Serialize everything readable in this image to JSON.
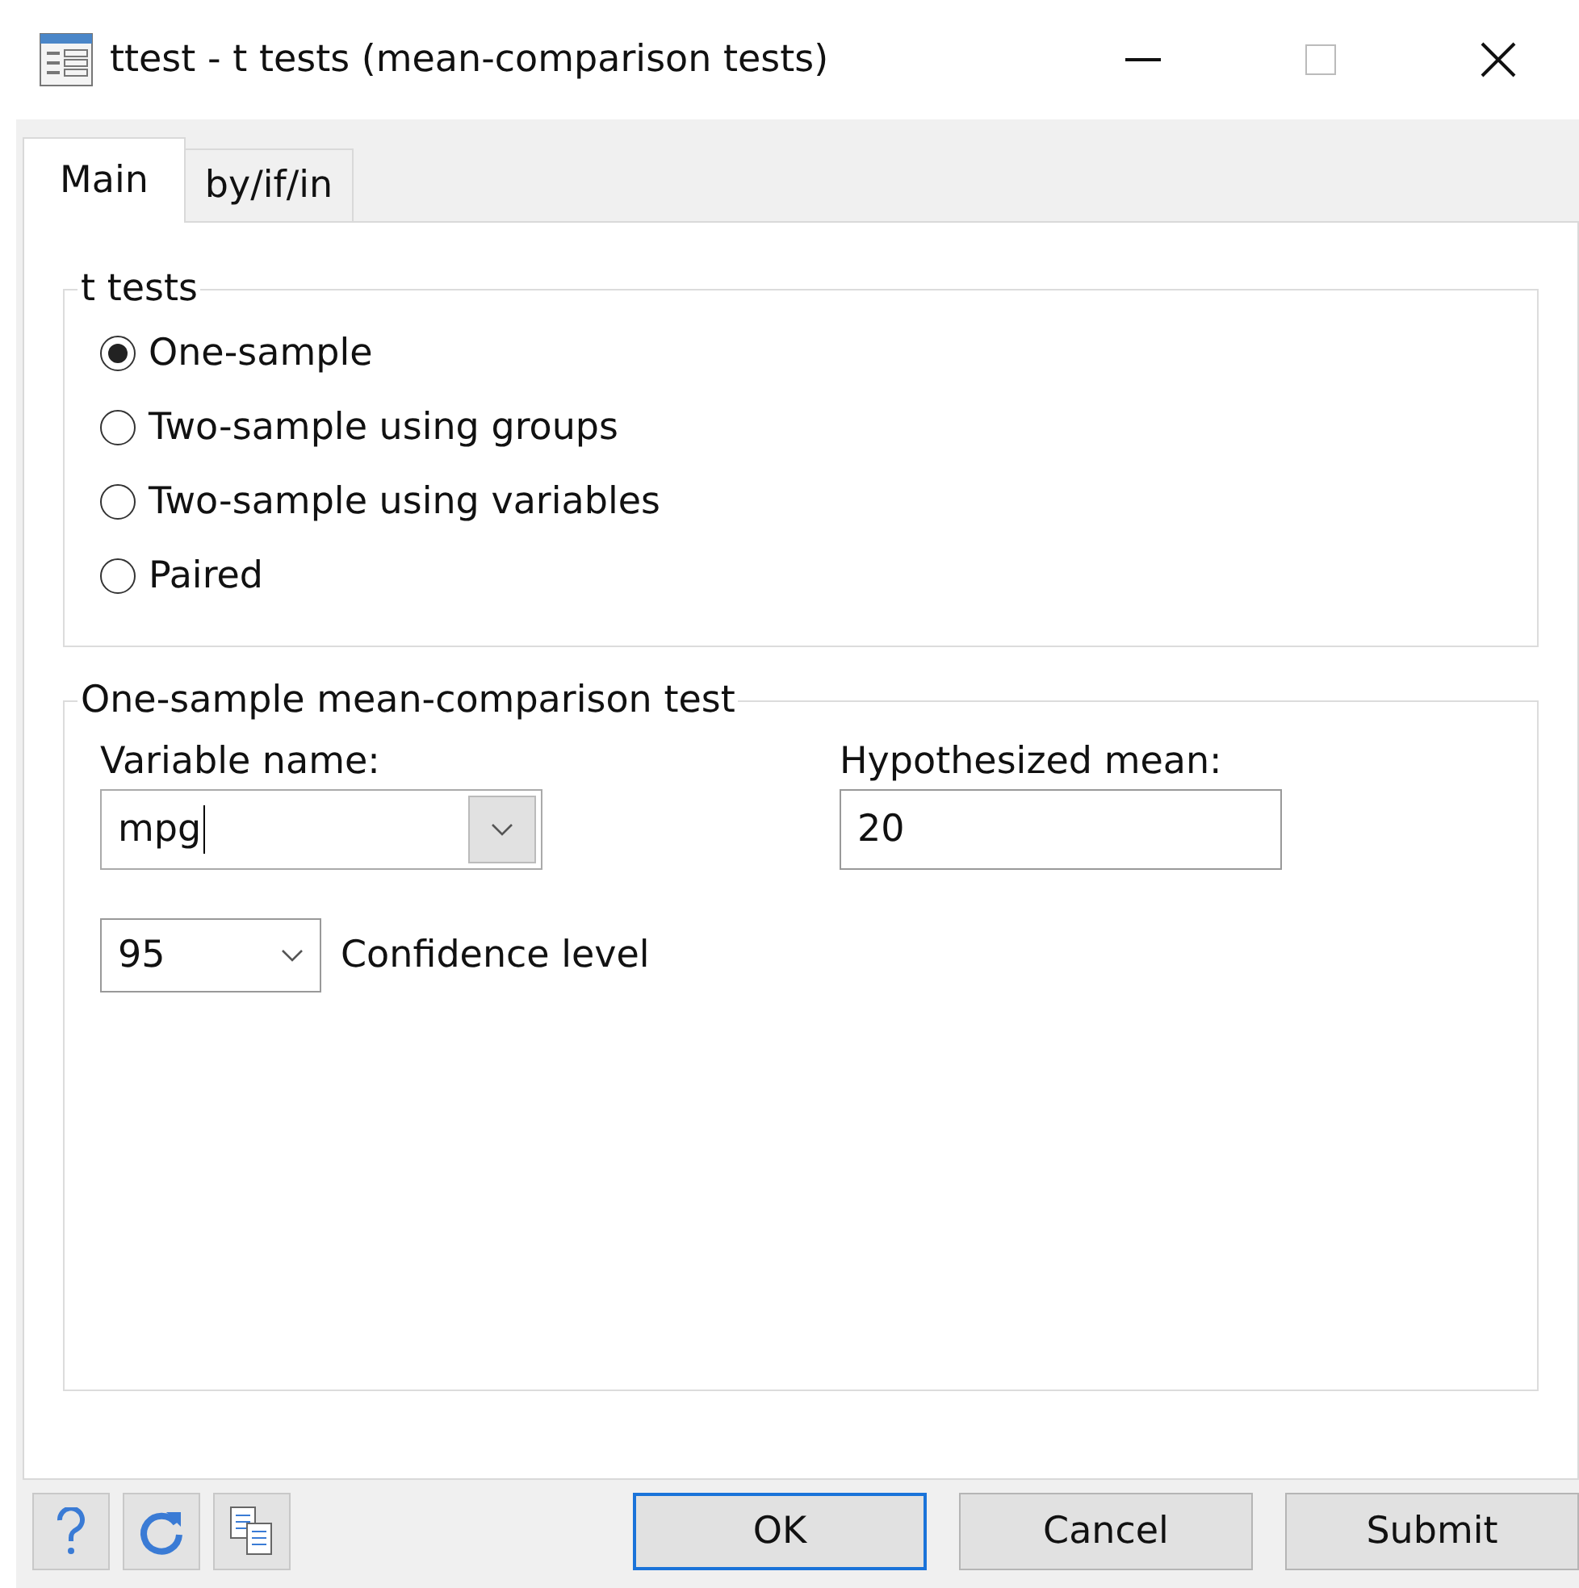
{
  "window": {
    "title": "ttest - t tests (mean-comparison tests)"
  },
  "tabs": [
    {
      "label": "Main",
      "selected": true
    },
    {
      "label": "by/if/in",
      "selected": false
    }
  ],
  "test_group": {
    "title": "t tests",
    "options": [
      {
        "label": "One-sample",
        "selected": true
      },
      {
        "label": "Two-sample using groups",
        "selected": false
      },
      {
        "label": "Two-sample using variables",
        "selected": false
      },
      {
        "label": "Paired",
        "selected": false
      }
    ]
  },
  "detail_group": {
    "title": "One-sample mean-comparison test",
    "variable": {
      "label": "Variable name:",
      "value": "mpg"
    },
    "mean": {
      "label": "Hypothesized mean:",
      "value": "20"
    },
    "confidence": {
      "value": "95",
      "label": "Confidence level"
    }
  },
  "buttons": [
    {
      "label": "OK",
      "default": true
    },
    {
      "label": "Cancel",
      "default": false
    },
    {
      "label": "Submit",
      "default": false
    }
  ]
}
